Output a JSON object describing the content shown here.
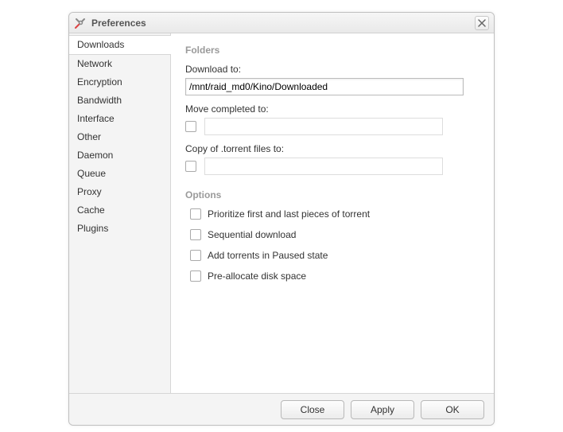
{
  "window": {
    "title": "Preferences"
  },
  "sidebar": {
    "items": [
      {
        "label": "Downloads",
        "selected": true
      },
      {
        "label": "Network"
      },
      {
        "label": "Encryption"
      },
      {
        "label": "Bandwidth"
      },
      {
        "label": "Interface"
      },
      {
        "label": "Other"
      },
      {
        "label": "Daemon"
      },
      {
        "label": "Queue"
      },
      {
        "label": "Proxy"
      },
      {
        "label": "Cache"
      },
      {
        "label": "Plugins"
      }
    ]
  },
  "content": {
    "folders_heading": "Folders",
    "download_to_label": "Download to:",
    "download_to_value": "/mnt/raid_md0/Kino/Downloaded",
    "move_completed_label": "Move completed to:",
    "move_completed_value": "",
    "copy_torrent_label": "Copy of .torrent files to:",
    "copy_torrent_value": "",
    "options_heading": "Options",
    "options": [
      {
        "label": "Prioritize first and last pieces of torrent"
      },
      {
        "label": "Sequential download"
      },
      {
        "label": "Add torrents in Paused state"
      },
      {
        "label": "Pre-allocate disk space"
      }
    ]
  },
  "footer": {
    "close": "Close",
    "apply": "Apply",
    "ok": "OK"
  }
}
